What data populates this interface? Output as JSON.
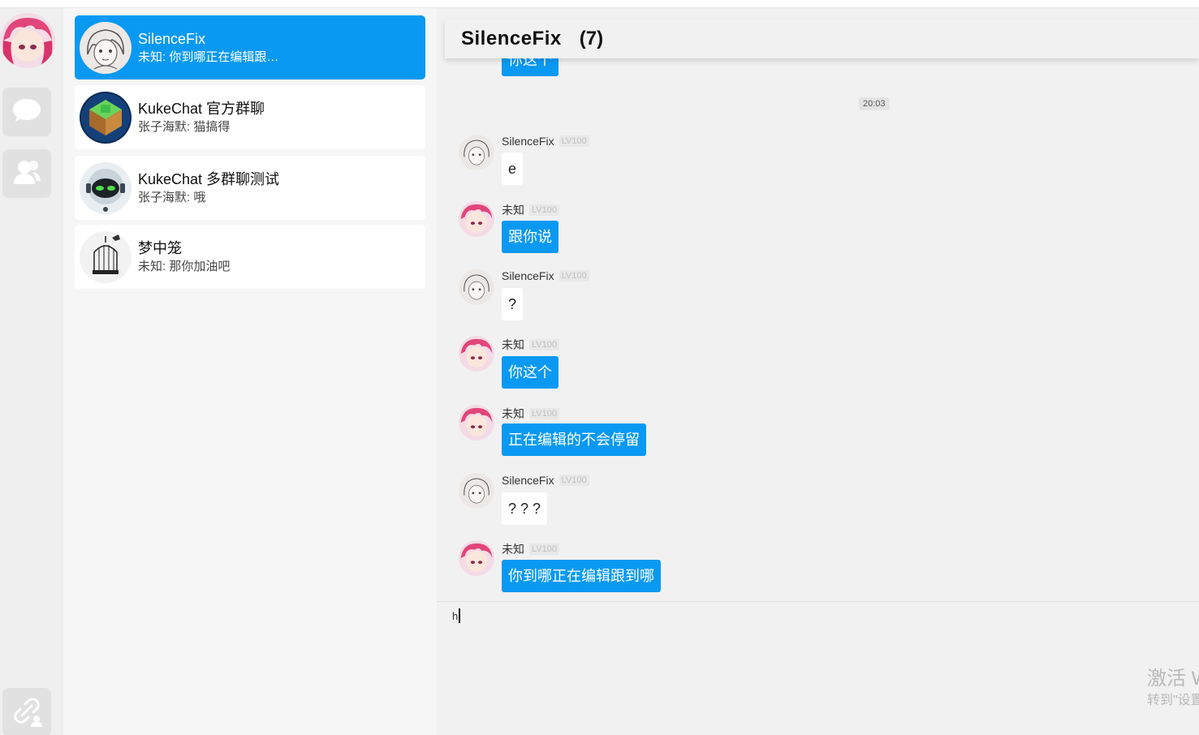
{
  "rail": {
    "nav_icons": [
      "chat-bubble-icon",
      "contacts-icon"
    ],
    "bottom_icon": "link-user-icon"
  },
  "conversations": [
    {
      "name": "SilenceFix",
      "last": "未知: 你到哪正在编辑跟…",
      "active": true,
      "avatar": "sketch-girl-avatar"
    },
    {
      "name": "KukeChat 官方群聊",
      "last": "张子海默: 猫搞得",
      "active": false,
      "avatar": "voxel-island-avatar"
    },
    {
      "name": "KukeChat 多群聊测试",
      "last": "张子海默: 哦",
      "active": false,
      "avatar": "robot-avatar"
    },
    {
      "name": "梦中笼",
      "last": "未知: 那你加油吧",
      "active": false,
      "avatar": "birdcage-avatar"
    }
  ],
  "chat": {
    "title": "SilenceFix",
    "count": "(7)",
    "partial_top_message": "你这个",
    "time_divider": "20:03",
    "messages": [
      {
        "sender": "SilenceFix",
        "level": "LV100",
        "text": "e",
        "self": false
      },
      {
        "sender": "未知",
        "level": "LV100",
        "text": "跟你说",
        "self": true
      },
      {
        "sender": "SilenceFix",
        "level": "LV100",
        "text": "?",
        "self": false
      },
      {
        "sender": "未知",
        "level": "LV100",
        "text": "你这个",
        "self": true
      },
      {
        "sender": "未知",
        "level": "LV100",
        "text": "正在编辑的不会停留",
        "self": true
      },
      {
        "sender": "SilenceFix",
        "level": "LV100",
        "text": "? ? ?",
        "self": false
      },
      {
        "sender": "未知",
        "level": "LV100",
        "text": "你到哪正在编辑跟到哪",
        "self": true
      }
    ],
    "input_value": "h"
  },
  "watermark": {
    "line1": "激活 W",
    "line2": "转到\"设置"
  },
  "colors": {
    "accent": "#0a99f2",
    "list_bg": "#f6f6f6",
    "chat_bg": "#f1f1f1"
  }
}
